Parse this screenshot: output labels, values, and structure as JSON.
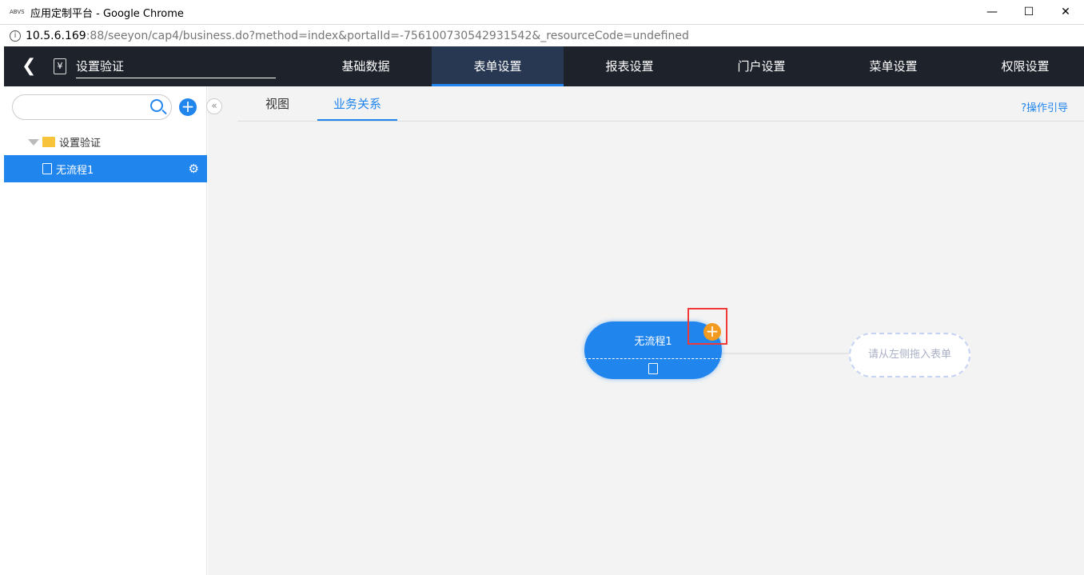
{
  "window": {
    "logo_text": "ABVS",
    "title": "应用定制平台 - Google Chrome",
    "controls": [
      "—",
      "☐",
      "✕"
    ]
  },
  "address": {
    "host": "10.5.6.169",
    "path": ":88/seeyon/cap4/business.do?method=index&portalId=-756100730542931542&_resourceCode=undefined"
  },
  "header": {
    "app_name": "设置验证",
    "tabs": [
      "基础数据",
      "表单设置",
      "报表设置",
      "门户设置",
      "菜单设置",
      "权限设置"
    ]
  },
  "sidebar": {
    "search_placeholder": "",
    "folder": "设置验证",
    "item": "无流程1"
  },
  "main": {
    "subtabs": [
      "视图",
      "业务关系"
    ],
    "guide": "?操作引导",
    "node_name": "无流程1",
    "drop_hint": "请从左侧拖入表单"
  }
}
